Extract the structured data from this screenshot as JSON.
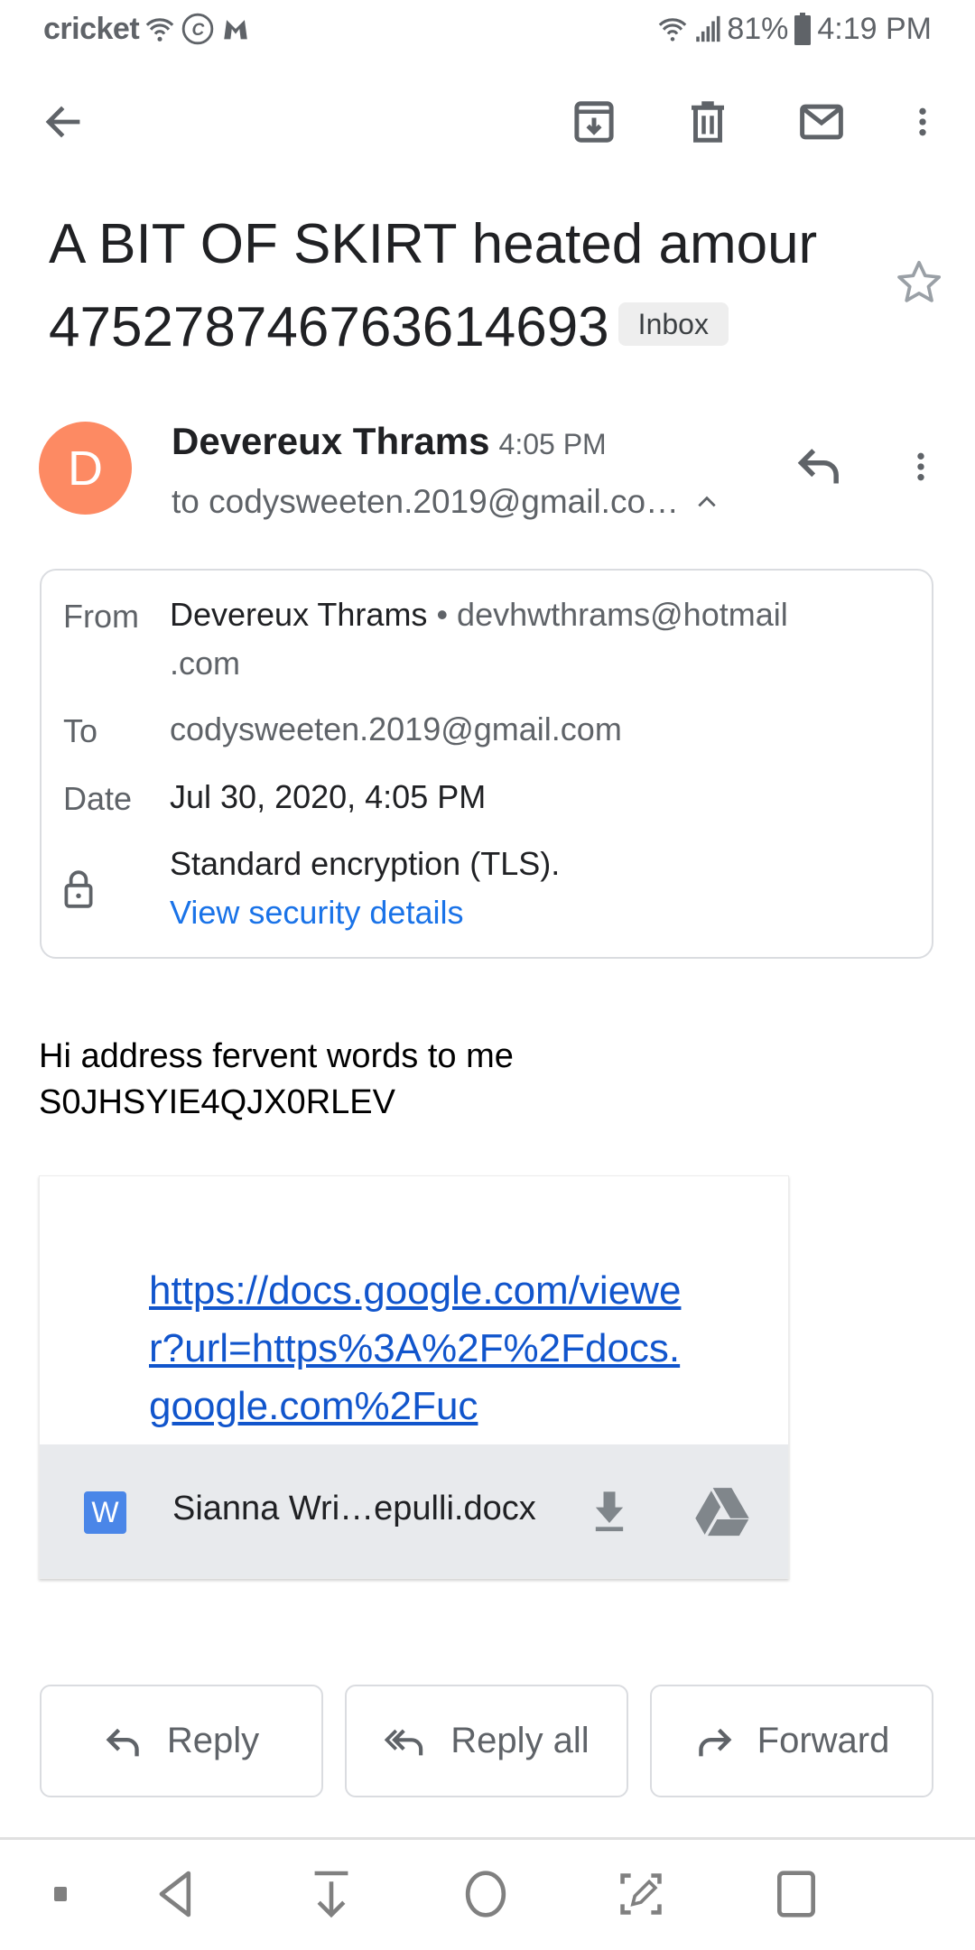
{
  "status_bar": {
    "carrier": "cricket",
    "battery": "81%",
    "time": "4:19 PM",
    "icons_left": [
      "wifi-calling-icon",
      "copyright-c-icon",
      "malwarebytes-icon"
    ],
    "icons_right": [
      "wifi-icon",
      "signal-icon",
      "battery-icon"
    ]
  },
  "toolbar": {
    "back": "back-arrow-icon",
    "actions": [
      "archive-icon",
      "delete-icon",
      "mark-unread-icon",
      "more-options-icon"
    ]
  },
  "subject": {
    "line1": "A BIT OF SKIRT heated amour",
    "line2": "47527874676361469​3",
    "label": "Inbox"
  },
  "message": {
    "avatar_letter": "D",
    "avatar_color": "#fd8a63",
    "sender": "Devereux Thrams",
    "time": "4:05 PM",
    "to_summary": "to codysweeten.2019@gmail.co…"
  },
  "details": {
    "from_label": "From",
    "from_name": "Devereux Thrams",
    "from_sep": " • ",
    "from_email_1": "devhwthrams@hotmail",
    "from_email_2": ".com",
    "to_label": "To",
    "to_value": "codysweeten.2019@gmail.com",
    "date_label": "Date",
    "date_value": "Jul 30, 2020, 4:05 PM",
    "encryption": "Standard encryption (TLS).",
    "security_link": "View security details"
  },
  "body": {
    "line1": "Hi address fervent words to me",
    "line2": "S0JHSYIE4QJX0RLEV"
  },
  "attachment": {
    "link_text": "https://docs.google.com/viewer?url=https%3A%2F%2Fdocs.google.com%2Fuc",
    "file_type_letter": "W",
    "file_name": "Sianna Wri…epulli.docx"
  },
  "actions": {
    "reply": "Reply",
    "reply_all": "Reply all",
    "forward": "Forward"
  },
  "colors": {
    "link": "#1155cc",
    "accent_blue": "#1a73e8",
    "icon_gray": "#5f6368"
  }
}
